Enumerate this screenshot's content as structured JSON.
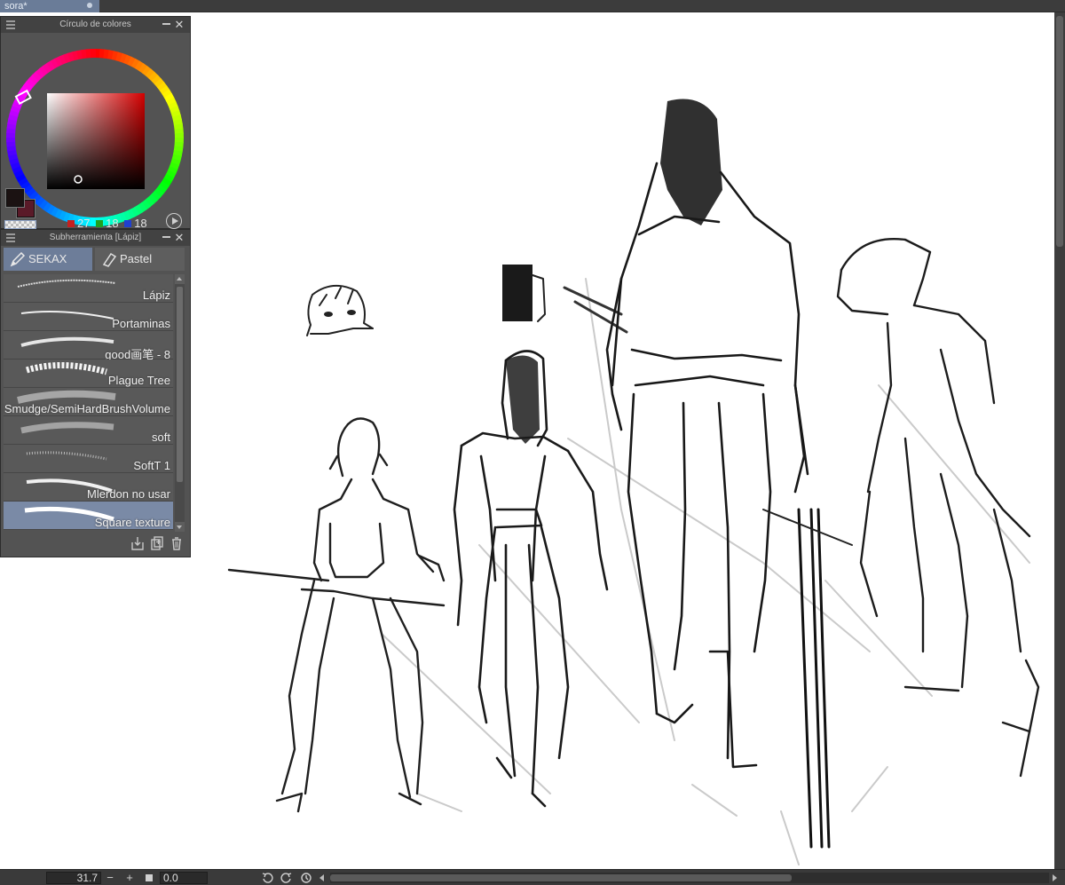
{
  "document_tab": {
    "label": "sora*"
  },
  "color_panel": {
    "title": "Círculo de colores",
    "rgb": {
      "r": "27",
      "g": "18",
      "b": "18"
    },
    "swatch_colors": {
      "r": "#c42020",
      "g": "#20a020",
      "b": "#2040d0"
    },
    "main_color": "#1b1212",
    "sub_color": "#5a1a28"
  },
  "subtool_panel": {
    "title": "Subherramienta [Lápiz]",
    "tabs": [
      {
        "label": "SEKAX"
      },
      {
        "label": "Pastel"
      }
    ],
    "brushes": [
      {
        "label": "Lápiz"
      },
      {
        "label": "Portaminas"
      },
      {
        "label": "good画笔 - 8"
      },
      {
        "label": "Plague Tree"
      },
      {
        "label": "Smudge/SemiHardBrushVolume"
      },
      {
        "label": "soft"
      },
      {
        "label": "SoftT 1"
      },
      {
        "label": "Mlerdon no usar"
      },
      {
        "label": "Square texture"
      }
    ]
  },
  "status_bar": {
    "zoom": "31.7",
    "rotation": "0.0",
    "zoom_out": "−",
    "zoom_in": "+"
  }
}
